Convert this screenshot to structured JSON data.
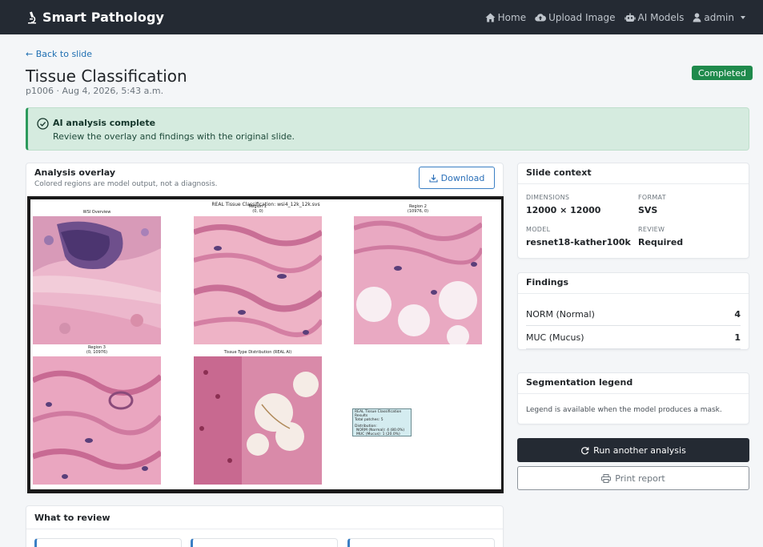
{
  "nav": {
    "brand": "Smart Pathology",
    "links": [
      {
        "label": "Home",
        "icon": "home-icon"
      },
      {
        "label": "Upload Image",
        "icon": "cloud-upload-icon"
      },
      {
        "label": "AI Models",
        "icon": "robot-icon"
      },
      {
        "label": "admin",
        "icon": "user-icon"
      }
    ]
  },
  "header": {
    "back": "← Back to slide",
    "title": "Tissue Classification",
    "subtitle": "p1006 · Aug 4, 2026, 5:43 a.m.",
    "status": "Completed"
  },
  "alert": {
    "title": "AI analysis complete",
    "text": "Review the overlay and findings with the original slide."
  },
  "overlay": {
    "title": "Analysis overlay",
    "subtitle": "Colored regions are model output, not a diagnosis.",
    "download": "Download",
    "figure": {
      "title": "REAL Tissue Classification: wsi4_12k_12k.svs",
      "panels": [
        {
          "label": "WSI Overview",
          "sub": ""
        },
        {
          "label": "Region 1",
          "sub": "(0, 0)"
        },
        {
          "label": "Region 2",
          "sub": "(10976, 0)"
        },
        {
          "label": "Region 3",
          "sub": "(0, 10976)"
        },
        {
          "label": "Tissue Type Distribution (REAL AI)",
          "sub": ""
        }
      ],
      "results": {
        "title": "REAL Tissue Classification Results",
        "total": "Total patches: 5",
        "dist_label": "Distribution:",
        "line1": "NORM (Normal): 4 (80.0%)",
        "line2": "MUC (Mucus): 1 (20.0%)"
      }
    }
  },
  "context": {
    "title": "Slide context",
    "dimensions_label": "DIMENSIONS",
    "dimensions": "12000 × 12000",
    "format_label": "FORMAT",
    "format": "SVS",
    "model_label": "MODEL",
    "model": "resnet18-kather100k",
    "review_label": "REVIEW",
    "review": "Required"
  },
  "findings": {
    "title": "Findings",
    "rows": [
      {
        "label": "NORM (Normal)",
        "count": "4"
      },
      {
        "label": "MUC (Mucus)",
        "count": "1"
      }
    ]
  },
  "legend": {
    "title": "Segmentation legend",
    "text": "Legend is available when the model produces a mask."
  },
  "actions": {
    "run": "Run another analysis",
    "print": "Print report"
  },
  "review": {
    "title": "What to review"
  },
  "colors": {
    "navbar": "#242a33",
    "success": "#1f8a4c",
    "link": "#1f6fb2",
    "tissue_pink": "#e49ab8",
    "nuclei": "#5a3f7a"
  }
}
